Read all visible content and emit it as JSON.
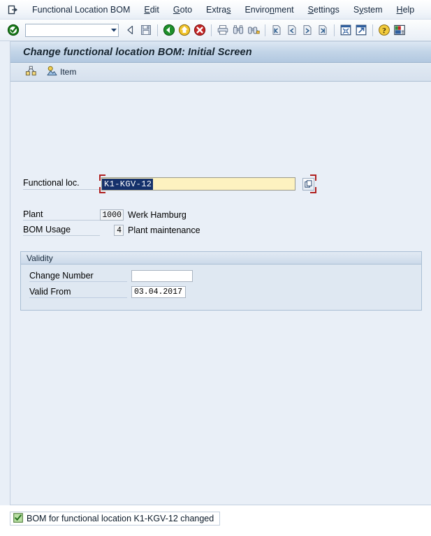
{
  "menubar": {
    "system_icon": "system-menu-icon",
    "items": [
      {
        "label": "Functional Location BOM",
        "accel_index": -1
      },
      {
        "label": "Edit",
        "accel_index": 0
      },
      {
        "label": "Goto",
        "accel_index": 0
      },
      {
        "label": "Extras",
        "accel_index": 4
      },
      {
        "label": "Environment",
        "accel_index": 6
      },
      {
        "label": "Settings",
        "accel_index": 0
      },
      {
        "label": "System",
        "accel_index": 1
      },
      {
        "label": "Help",
        "accel_index": 0
      }
    ]
  },
  "toolbar": {
    "command_value": "",
    "command_placeholder": "",
    "icons": [
      "enter-check-icon",
      "command-field",
      "dropdown-arrow-icon",
      "back-triangle-icon",
      "save-disk-icon",
      "back-green-arrow-icon",
      "exit-yellow-arrow-icon",
      "cancel-red-x-icon",
      "print-icon",
      "find-binoculars-icon",
      "find-next-binoculars-icon",
      "first-page-icon",
      "previous-page-icon",
      "next-page-icon",
      "last-page-icon",
      "create-session-icon",
      "create-shortcut-icon",
      "help-question-icon",
      "customize-layout-icon"
    ]
  },
  "screen": {
    "title": "Change functional location BOM: Initial Screen",
    "app_toolbar": {
      "structure_icon": "structure-overview-icon",
      "item_icon": "item-overview-icon",
      "item_label": "Item"
    }
  },
  "form": {
    "functional_loc": {
      "label": "Functional loc.",
      "value": "K1-KGV-12",
      "selected": true,
      "f4_icon": "value-help-icon"
    },
    "plant": {
      "label": "Plant",
      "value": "1000",
      "description": "Werk Hamburg"
    },
    "bom_usage": {
      "label": "BOM Usage",
      "value": "4",
      "description": "Plant maintenance"
    }
  },
  "validity": {
    "title": "Validity",
    "change_number": {
      "label": "Change Number",
      "value": ""
    },
    "valid_from": {
      "label": "Valid From",
      "value": "03.04.2017"
    }
  },
  "statusbar": {
    "icon": "success-check-icon",
    "message": "BOM for functional location K1-KGV-12 changed"
  },
  "colors": {
    "title_bar": "#b2c8e0",
    "canvas": "#e9eff7",
    "focused_field": "#fdf2c0",
    "selection": "#15316b",
    "focus_bracket": "#b02020",
    "success": "#3a8c3a"
  }
}
